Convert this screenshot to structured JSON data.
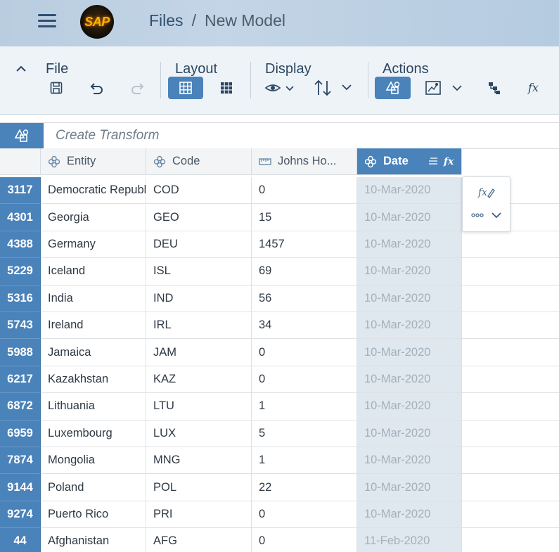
{
  "shell": {
    "logo_text": "SAP",
    "breadcrumb": [
      {
        "label": "Files"
      },
      {
        "label": "New Model"
      }
    ],
    "separator": "/"
  },
  "toolbar": {
    "groups": {
      "file": "File",
      "layout": "Layout",
      "display": "Display",
      "actions": "Actions"
    },
    "icons": [
      "collapse-icon",
      "save-icon",
      "undo-icon",
      "redo-icon",
      "grid-view-icon",
      "table-view-icon",
      "show-icon",
      "sort-icon",
      "transform-icon",
      "geo-enrich-icon",
      "hierarchy-icon",
      "formula-icon"
    ]
  },
  "transform": {
    "placeholder": "Create Transform"
  },
  "grid": {
    "columns": [
      {
        "label": "Entity",
        "icon": "dimension-icon"
      },
      {
        "label": "Code",
        "icon": "dimension-icon"
      },
      {
        "label": "Johns Ho...",
        "icon": "measure-icon"
      },
      {
        "label": "Date",
        "icon": "dimension-icon",
        "selected": true
      }
    ],
    "rows": [
      {
        "num": "3117",
        "entity": "Democratic Republ",
        "code": "COD",
        "value": "0",
        "date": "10-Mar-2020"
      },
      {
        "num": "4301",
        "entity": "Georgia",
        "code": "GEO",
        "value": "15",
        "date": "10-Mar-2020"
      },
      {
        "num": "4388",
        "entity": "Germany",
        "code": "DEU",
        "value": "1457",
        "date": "10-Mar-2020"
      },
      {
        "num": "5229",
        "entity": "Iceland",
        "code": "ISL",
        "value": "69",
        "date": "10-Mar-2020"
      },
      {
        "num": "5316",
        "entity": "India",
        "code": "IND",
        "value": "56",
        "date": "10-Mar-2020"
      },
      {
        "num": "5743",
        "entity": "Ireland",
        "code": "IRL",
        "value": "34",
        "date": "10-Mar-2020"
      },
      {
        "num": "5988",
        "entity": "Jamaica",
        "code": "JAM",
        "value": "0",
        "date": "10-Mar-2020"
      },
      {
        "num": "6217",
        "entity": "Kazakhstan",
        "code": "KAZ",
        "value": "0",
        "date": "10-Mar-2020"
      },
      {
        "num": "6872",
        "entity": "Lithuania",
        "code": "LTU",
        "value": "1",
        "date": "10-Mar-2020"
      },
      {
        "num": "6959",
        "entity": "Luxembourg",
        "code": "LUX",
        "value": "5",
        "date": "10-Mar-2020"
      },
      {
        "num": "7874",
        "entity": "Mongolia",
        "code": "MNG",
        "value": "1",
        "date": "10-Mar-2020"
      },
      {
        "num": "9144",
        "entity": "Poland",
        "code": "POL",
        "value": "22",
        "date": "10-Mar-2020"
      },
      {
        "num": "9274",
        "entity": "Puerto Rico",
        "code": "PRI",
        "value": "0",
        "date": "10-Mar-2020"
      },
      {
        "num": "44",
        "entity": "Afghanistan",
        "code": "AFG",
        "value": "0",
        "date": "11-Feb-2020"
      }
    ]
  },
  "popover": {
    "icons": [
      "edit-formula-icon",
      "more-options-icon"
    ]
  },
  "colors": {
    "accent": "#4a82ba",
    "shell_bg": "#bfd2e5",
    "toolbar_bg": "#eef3f8",
    "selected_column_bg": "#dfe7ef"
  }
}
